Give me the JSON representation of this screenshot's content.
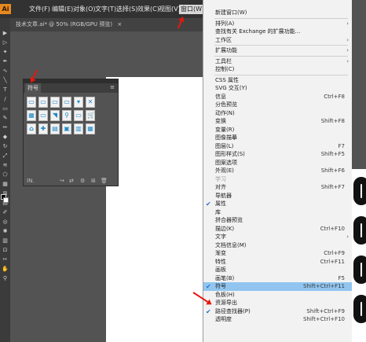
{
  "app": {
    "logo": "Ai"
  },
  "menubar": {
    "items": [
      "文件(F)",
      "编辑(E)",
      "对象(O)",
      "文字(T)",
      "选择(S)",
      "效果(C)",
      "视图(V)",
      "窗口(W)"
    ]
  },
  "document_tab": {
    "label": "技术文章.ai* @ 50% (RGB/GPU 预览)",
    "close": "×"
  },
  "panel": {
    "tab_label": "符号",
    "close": "×",
    "menu_glyph": "≡",
    "footer_icons": [
      "library-menu-icon",
      "place-symbol-instance-icon",
      "break-link-icon",
      "symbol-options-icon",
      "new-symbol-icon",
      "delete-symbol-icon"
    ],
    "footer_glyphs": [
      "IN.",
      "↪",
      "⇄",
      "⚙",
      "⊞",
      "🗑"
    ],
    "symbol_glyphs": [
      "▭",
      "▭",
      "▭",
      "▭",
      "▾",
      "✕",
      "▦",
      "▭",
      "◥",
      "⚲",
      "▭",
      "🛒",
      "⌂",
      "✚",
      "▤",
      "▣",
      "▥",
      "▦"
    ],
    "symbol_names": [
      "button-blank-1",
      "button-blank-2",
      "button-blank-3",
      "button-blank-4",
      "dropdown-arrow",
      "close-box",
      "calendar",
      "text-box",
      "rss-feed",
      "search",
      "scroll-bar",
      "cart",
      "home",
      "first-aid",
      "print",
      "itunes",
      "list",
      "grid"
    ]
  },
  "window_menu": {
    "items": [
      {
        "label": "新建窗口(W)",
        "shortcut": "",
        "submenu": false,
        "checked": false
      },
      {
        "sep": true
      },
      {
        "label": "排列(A)",
        "shortcut": "",
        "submenu": true,
        "checked": false
      },
      {
        "label": "查找有关 Exchange 的扩展功能...",
        "shortcut": "",
        "submenu": false,
        "checked": false
      },
      {
        "label": "工作区",
        "shortcut": "",
        "submenu": true,
        "checked": false
      },
      {
        "sep": true
      },
      {
        "label": "扩展功能",
        "shortcut": "",
        "submenu": true,
        "checked": false
      },
      {
        "sep": true
      },
      {
        "label": "工具栏",
        "shortcut": "",
        "submenu": true,
        "checked": false
      },
      {
        "label": "控制(C)",
        "shortcut": "",
        "submenu": false,
        "checked": false
      },
      {
        "sep": true
      },
      {
        "label": "CSS 属性",
        "shortcut": "",
        "submenu": false,
        "checked": false
      },
      {
        "label": "SVG 交互(Y)",
        "shortcut": "",
        "submenu": false,
        "checked": false
      },
      {
        "label": "信息",
        "shortcut": "Ctrl+F8",
        "submenu": false,
        "checked": false
      },
      {
        "label": "分色预览",
        "shortcut": "",
        "submenu": false,
        "checked": false
      },
      {
        "label": "动作(N)",
        "shortcut": "",
        "submenu": false,
        "checked": false
      },
      {
        "label": "变换",
        "shortcut": "Shift+F8",
        "submenu": false,
        "checked": false
      },
      {
        "label": "变量(R)",
        "shortcut": "",
        "submenu": false,
        "checked": false
      },
      {
        "label": "图像描摹",
        "shortcut": "",
        "submenu": false,
        "checked": false
      },
      {
        "label": "图层(L)",
        "shortcut": "F7",
        "submenu": false,
        "checked": false
      },
      {
        "label": "图形样式(S)",
        "shortcut": "Shift+F5",
        "submenu": false,
        "checked": false
      },
      {
        "label": "图案选项",
        "shortcut": "",
        "submenu": false,
        "checked": false
      },
      {
        "label": "外观(E)",
        "shortcut": "Shift+F6",
        "submenu": false,
        "checked": false
      },
      {
        "label": "学习",
        "shortcut": "",
        "submenu": false,
        "checked": false,
        "disabled": true
      },
      {
        "label": "对齐",
        "shortcut": "Shift+F7",
        "submenu": false,
        "checked": false
      },
      {
        "label": "导航器",
        "shortcut": "",
        "submenu": false,
        "checked": false
      },
      {
        "label": "属性",
        "shortcut": "",
        "submenu": false,
        "checked": true
      },
      {
        "label": "库",
        "shortcut": "",
        "submenu": false,
        "checked": false
      },
      {
        "label": "拼合器预览",
        "shortcut": "",
        "submenu": false,
        "checked": false
      },
      {
        "label": "描边(K)",
        "shortcut": "Ctrl+F10",
        "submenu": false,
        "checked": false
      },
      {
        "label": "文字",
        "shortcut": "",
        "submenu": true,
        "checked": false
      },
      {
        "label": "文档信息(M)",
        "shortcut": "",
        "submenu": false,
        "checked": false
      },
      {
        "label": "渐变",
        "shortcut": "Ctrl+F9",
        "submenu": false,
        "checked": false
      },
      {
        "label": "特性",
        "shortcut": "Ctrl+F11",
        "submenu": false,
        "checked": false
      },
      {
        "label": "画板",
        "shortcut": "",
        "submenu": false,
        "checked": false
      },
      {
        "label": "画笔(B)",
        "shortcut": "F5",
        "submenu": false,
        "checked": false
      },
      {
        "label": "符号",
        "shortcut": "Shift+Ctrl+F11",
        "submenu": false,
        "checked": true,
        "highlighted": true
      },
      {
        "label": "色板(H)",
        "shortcut": "",
        "submenu": false,
        "checked": false
      },
      {
        "label": "资源导出",
        "shortcut": "",
        "submenu": false,
        "checked": false
      },
      {
        "label": "路径查找器(P)",
        "shortcut": "Shift+Ctrl+F9",
        "submenu": false,
        "checked": true
      },
      {
        "label": "透明度",
        "shortcut": "Shift+Ctrl+F10",
        "submenu": false,
        "checked": false
      }
    ]
  },
  "colors": {
    "accent_highlight": "#91c5f0",
    "annotation_arrow": "#e8170b",
    "logo": "#e5891f"
  }
}
